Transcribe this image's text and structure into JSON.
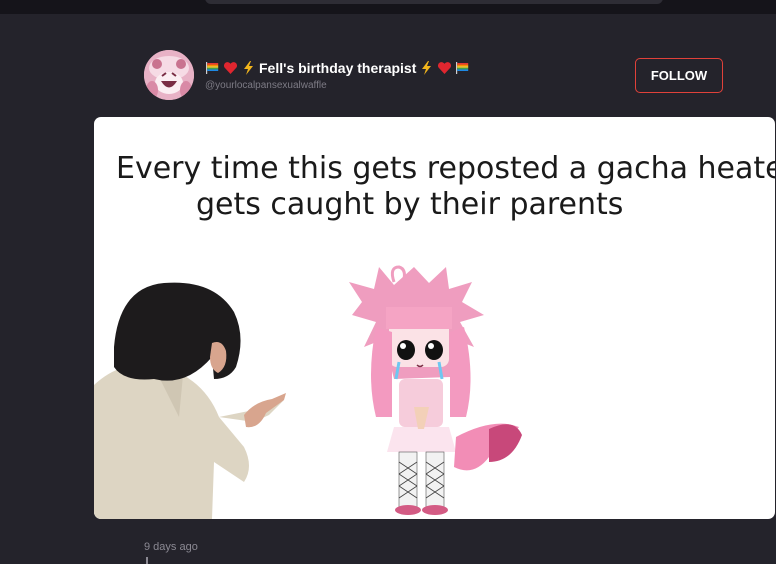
{
  "post": {
    "author": {
      "display_name": "Fell's birthday therapist",
      "handle": "@yourlocalpansexualwaffle",
      "avatar_icon": "pink-smiling-character-avatar",
      "name_decorations": [
        "pride-flag-icon",
        "heart-icon",
        "lightning-icon"
      ]
    },
    "follow_label": "FOLLOW",
    "image": {
      "caption_line1": "Every time this gets reposted a gacha heater",
      "caption_line2": "gets caught by their parents"
    },
    "timestamp": "9 days ago"
  },
  "colors": {
    "background": "#24232b",
    "follow_border": "#e0413a",
    "heart": "#e0262f",
    "lightning": "#f2b51c"
  }
}
